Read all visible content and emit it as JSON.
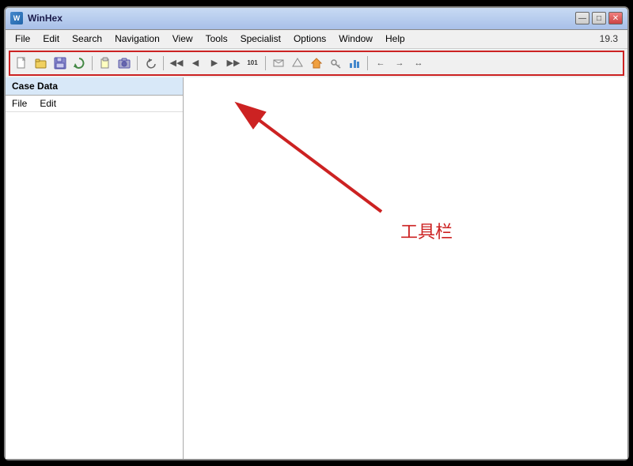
{
  "window": {
    "title": "WinHex",
    "version": "19.3"
  },
  "titlebar": {
    "minimize_label": "—",
    "restore_label": "□",
    "close_label": "✕"
  },
  "menu": {
    "items": [
      {
        "label": "File"
      },
      {
        "label": "Edit"
      },
      {
        "label": "Search"
      },
      {
        "label": "Navigation"
      },
      {
        "label": "View"
      },
      {
        "label": "Tools"
      },
      {
        "label": "Specialist"
      },
      {
        "label": "Options"
      },
      {
        "label": "Window"
      },
      {
        "label": "Help"
      }
    ]
  },
  "toolbar": {
    "buttons": [
      {
        "icon": "📄",
        "name": "new"
      },
      {
        "icon": "📂",
        "name": "open"
      },
      {
        "icon": "💾",
        "name": "save-partial"
      },
      {
        "icon": "🔄",
        "name": "refresh"
      },
      {
        "icon": "⬛",
        "name": "spacer1"
      },
      {
        "icon": "📋",
        "name": "paste"
      },
      {
        "icon": "📸",
        "name": "screenshot"
      },
      {
        "icon": "⬛",
        "name": "spacer2"
      },
      {
        "icon": "↩",
        "name": "undo"
      },
      {
        "icon": "⬛",
        "name": "spacer3"
      },
      {
        "icon": "◀◀",
        "name": "prev-block"
      },
      {
        "icon": "◀",
        "name": "prev"
      },
      {
        "icon": "▶",
        "name": "next"
      },
      {
        "icon": "▶▶",
        "name": "next-block"
      },
      {
        "icon": "🔢",
        "name": "counter"
      },
      {
        "icon": "⬛",
        "name": "spacer4"
      },
      {
        "icon": "⚡",
        "name": "tool1"
      },
      {
        "icon": "🔧",
        "name": "tool2"
      },
      {
        "icon": "🏠",
        "name": "home"
      },
      {
        "icon": "🔑",
        "name": "key"
      },
      {
        "icon": "📊",
        "name": "stats"
      },
      {
        "icon": "⬛",
        "name": "spacer5"
      },
      {
        "icon": "⬅",
        "name": "go-back"
      },
      {
        "icon": "➡",
        "name": "go-forward"
      },
      {
        "icon": "↔",
        "name": "go-nav"
      }
    ]
  },
  "left_panel": {
    "title": "Case Data",
    "menu_items": [
      {
        "label": "File"
      },
      {
        "label": "Edit"
      }
    ]
  },
  "annotation": {
    "text": "工具栏"
  }
}
